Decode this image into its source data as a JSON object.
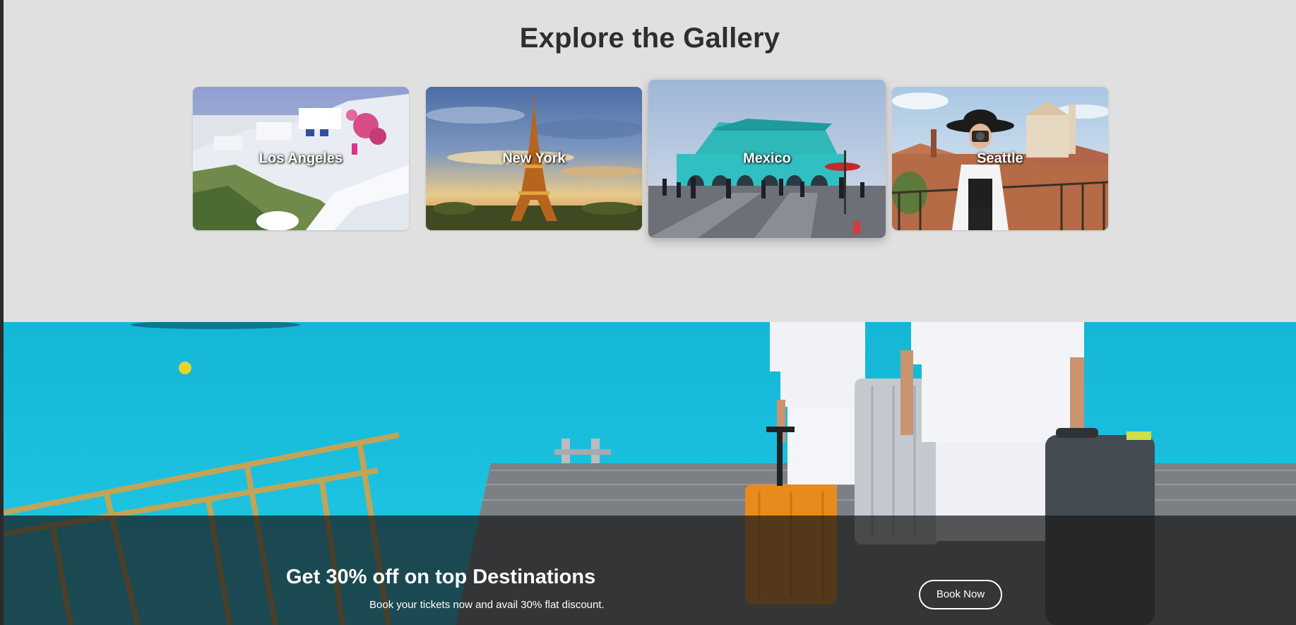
{
  "gallery": {
    "title": "Explore the Gallery",
    "cards": [
      {
        "label": "Los Angeles"
      },
      {
        "label": "New York"
      },
      {
        "label": "Mexico"
      },
      {
        "label": "Seattle"
      }
    ]
  },
  "promo": {
    "title": "Get 30% off on top Destinations",
    "subtitle": "Book your tickets now and avail 30% flat discount.",
    "button_label": "Book Now"
  },
  "colors": {
    "page_background": "#e0e0e0",
    "title_text": "#2e2e2e",
    "sea": "#1cc3e0",
    "overlay": "#191919"
  }
}
